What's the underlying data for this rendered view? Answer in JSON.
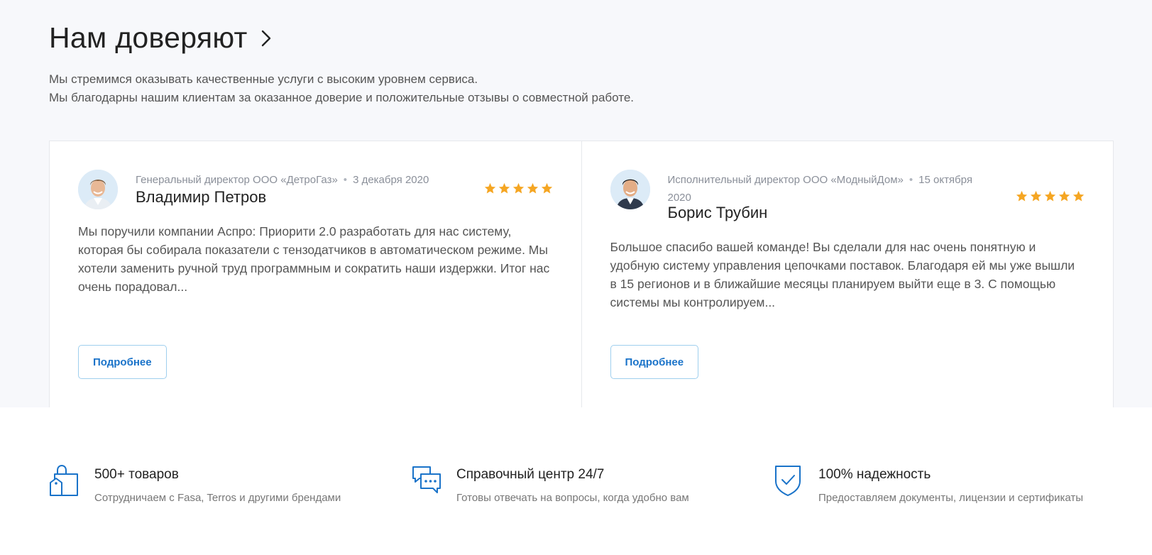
{
  "section": {
    "title": "Нам доверяют",
    "intro_line1": "Мы стремимся оказывать качественные услуги с высоким уровнем сервиса.",
    "intro_line2": "Мы благодарны нашим клиентам за оказанное доверие и положительные отзывы о совместной работе."
  },
  "reviews": [
    {
      "position": "Генеральный директор ООО «ДетроГаз»",
      "date": "3 декабря 2020",
      "name": "Владимир Петров",
      "rating": 5,
      "text": "Мы поручили компании Аспро: Приорити 2.0 разработать для нас систему, которая бы собирала показатели с тензодатчиков в автоматическом режиме. Мы хотели заменить ручной труд программным и сократить наши издержки. Итог нас очень порадовал...",
      "button": "Подробнее"
    },
    {
      "position": "Исполнительный директор ООО «МодныйДом»",
      "date": "15 октября 2020",
      "name": "Борис Трубин",
      "rating": 5,
      "text": "Большое спасибо вашей команде! Вы сделали для нас очень понятную и удобную систему управления цепочками поставок. Благодаря ей мы уже вышли в 15 регионов и в ближайшие месяцы планируем выйти еще в 3. С помощью системы мы контролируем...",
      "button": "Подробнее"
    }
  ],
  "features": [
    {
      "icon": "shopping-bag-icon",
      "title": "500+ товаров",
      "subtitle": "Сотрудничаем с Fasa, Terros и другими брендами"
    },
    {
      "icon": "chat-bubbles-icon",
      "title": "Справочный центр 24/7",
      "subtitle": "Готовы отвечать на вопросы, когда удобно вам"
    },
    {
      "icon": "shield-check-icon",
      "title": "100% надежность",
      "subtitle": "Предоставляем документы, лицензии и сертификаты"
    }
  ],
  "colors": {
    "accent": "#1a73c9",
    "star": "#f5a623",
    "background_top": "#f7f8fb"
  }
}
